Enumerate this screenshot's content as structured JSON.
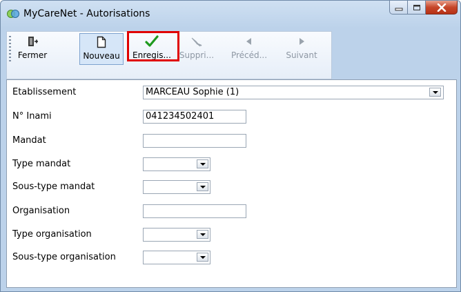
{
  "window": {
    "title": "MyCareNet - Autorisations"
  },
  "toolbar": {
    "buttons": [
      {
        "label": "Fermer",
        "icon": "exit-door-icon",
        "enabled": true
      },
      {
        "label": "Nouveau",
        "icon": "new-document-icon",
        "enabled": true,
        "selected": true
      },
      {
        "label": "Enregis...",
        "icon": "checkmark-icon",
        "enabled": true,
        "highlighted": true
      },
      {
        "label": "Suppri...",
        "icon": "eraser-icon",
        "enabled": false
      },
      {
        "label": "Précéd...",
        "icon": "arrow-left-icon",
        "enabled": false
      },
      {
        "label": "Suivant",
        "icon": "arrow-right-icon",
        "enabled": false
      }
    ]
  },
  "form": {
    "etablissement": {
      "label": "Etablissement",
      "value": "MARCEAU Sophie (1)"
    },
    "inami": {
      "label": "N° Inami",
      "value": "041234502401"
    },
    "mandat": {
      "label": "Mandat",
      "value": ""
    },
    "type_mandat": {
      "label": "Type mandat",
      "value": ""
    },
    "sous_type_mandat": {
      "label": "Sous-type mandat",
      "value": ""
    },
    "organisation": {
      "label": "Organisation",
      "value": ""
    },
    "type_organisation": {
      "label": "Type organisation",
      "value": ""
    },
    "sous_type_organisation": {
      "label": "Sous-type organisation",
      "value": ""
    }
  },
  "colors": {
    "highlight": "#e00000",
    "check_green": "#1e9a1e",
    "window_frame": "#bcd2ea"
  }
}
